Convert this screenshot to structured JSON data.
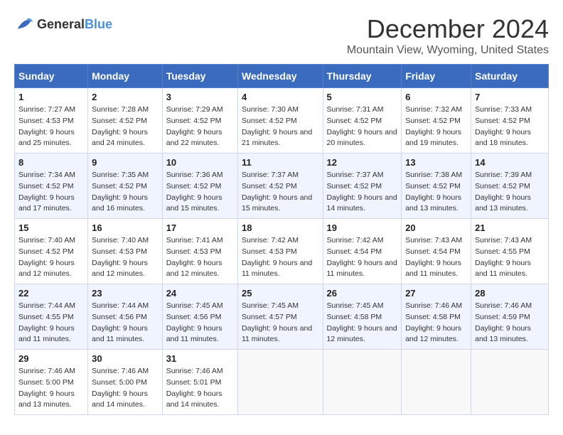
{
  "logo": {
    "text_general": "General",
    "text_blue": "Blue"
  },
  "title": "December 2024",
  "subtitle": "Mountain View, Wyoming, United States",
  "days_of_week": [
    "Sunday",
    "Monday",
    "Tuesday",
    "Wednesday",
    "Thursday",
    "Friday",
    "Saturday"
  ],
  "weeks": [
    [
      {
        "day": 1,
        "sunrise": "7:27 AM",
        "sunset": "4:53 PM",
        "daylight": "9 hours and 25 minutes."
      },
      {
        "day": 2,
        "sunrise": "7:28 AM",
        "sunset": "4:52 PM",
        "daylight": "9 hours and 24 minutes."
      },
      {
        "day": 3,
        "sunrise": "7:29 AM",
        "sunset": "4:52 PM",
        "daylight": "9 hours and 22 minutes."
      },
      {
        "day": 4,
        "sunrise": "7:30 AM",
        "sunset": "4:52 PM",
        "daylight": "9 hours and 21 minutes."
      },
      {
        "day": 5,
        "sunrise": "7:31 AM",
        "sunset": "4:52 PM",
        "daylight": "9 hours and 20 minutes."
      },
      {
        "day": 6,
        "sunrise": "7:32 AM",
        "sunset": "4:52 PM",
        "daylight": "9 hours and 19 minutes."
      },
      {
        "day": 7,
        "sunrise": "7:33 AM",
        "sunset": "4:52 PM",
        "daylight": "9 hours and 18 minutes."
      }
    ],
    [
      {
        "day": 8,
        "sunrise": "7:34 AM",
        "sunset": "4:52 PM",
        "daylight": "9 hours and 17 minutes."
      },
      {
        "day": 9,
        "sunrise": "7:35 AM",
        "sunset": "4:52 PM",
        "daylight": "9 hours and 16 minutes."
      },
      {
        "day": 10,
        "sunrise": "7:36 AM",
        "sunset": "4:52 PM",
        "daylight": "9 hours and 15 minutes."
      },
      {
        "day": 11,
        "sunrise": "7:37 AM",
        "sunset": "4:52 PM",
        "daylight": "9 hours and 15 minutes."
      },
      {
        "day": 12,
        "sunrise": "7:37 AM",
        "sunset": "4:52 PM",
        "daylight": "9 hours and 14 minutes."
      },
      {
        "day": 13,
        "sunrise": "7:38 AM",
        "sunset": "4:52 PM",
        "daylight": "9 hours and 13 minutes."
      },
      {
        "day": 14,
        "sunrise": "7:39 AM",
        "sunset": "4:52 PM",
        "daylight": "9 hours and 13 minutes."
      }
    ],
    [
      {
        "day": 15,
        "sunrise": "7:40 AM",
        "sunset": "4:52 PM",
        "daylight": "9 hours and 12 minutes."
      },
      {
        "day": 16,
        "sunrise": "7:40 AM",
        "sunset": "4:53 PM",
        "daylight": "9 hours and 12 minutes."
      },
      {
        "day": 17,
        "sunrise": "7:41 AM",
        "sunset": "4:53 PM",
        "daylight": "9 hours and 12 minutes."
      },
      {
        "day": 18,
        "sunrise": "7:42 AM",
        "sunset": "4:53 PM",
        "daylight": "9 hours and 11 minutes."
      },
      {
        "day": 19,
        "sunrise": "7:42 AM",
        "sunset": "4:54 PM",
        "daylight": "9 hours and 11 minutes."
      },
      {
        "day": 20,
        "sunrise": "7:43 AM",
        "sunset": "4:54 PM",
        "daylight": "9 hours and 11 minutes."
      },
      {
        "day": 21,
        "sunrise": "7:43 AM",
        "sunset": "4:55 PM",
        "daylight": "9 hours and 11 minutes."
      }
    ],
    [
      {
        "day": 22,
        "sunrise": "7:44 AM",
        "sunset": "4:55 PM",
        "daylight": "9 hours and 11 minutes."
      },
      {
        "day": 23,
        "sunrise": "7:44 AM",
        "sunset": "4:56 PM",
        "daylight": "9 hours and 11 minutes."
      },
      {
        "day": 24,
        "sunrise": "7:45 AM",
        "sunset": "4:56 PM",
        "daylight": "9 hours and 11 minutes."
      },
      {
        "day": 25,
        "sunrise": "7:45 AM",
        "sunset": "4:57 PM",
        "daylight": "9 hours and 11 minutes."
      },
      {
        "day": 26,
        "sunrise": "7:45 AM",
        "sunset": "4:58 PM",
        "daylight": "9 hours and 12 minutes."
      },
      {
        "day": 27,
        "sunrise": "7:46 AM",
        "sunset": "4:58 PM",
        "daylight": "9 hours and 12 minutes."
      },
      {
        "day": 28,
        "sunrise": "7:46 AM",
        "sunset": "4:59 PM",
        "daylight": "9 hours and 13 minutes."
      }
    ],
    [
      {
        "day": 29,
        "sunrise": "7:46 AM",
        "sunset": "5:00 PM",
        "daylight": "9 hours and 13 minutes."
      },
      {
        "day": 30,
        "sunrise": "7:46 AM",
        "sunset": "5:00 PM",
        "daylight": "9 hours and 14 minutes."
      },
      {
        "day": 31,
        "sunrise": "7:46 AM",
        "sunset": "5:01 PM",
        "daylight": "9 hours and 14 minutes."
      },
      null,
      null,
      null,
      null
    ]
  ],
  "labels": {
    "sunrise": "Sunrise:",
    "sunset": "Sunset:",
    "daylight": "Daylight:"
  }
}
